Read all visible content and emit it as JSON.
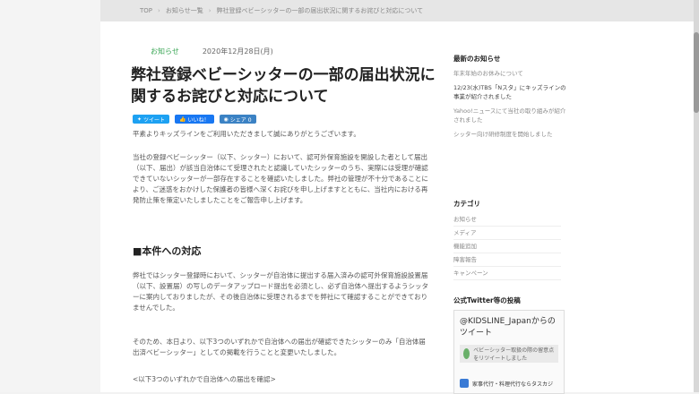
{
  "breadcrumb": {
    "home": "TOP",
    "section": "お知らせ一覧",
    "current": "弊社登録ベビーシッターの一部の届出状況に関するお詫びと対応について"
  },
  "article": {
    "category": "お知らせ",
    "date": "2020年12月28日(月)",
    "title": "弊社登録ベビーシッターの一部の届出状況に関するお詫びと対応について",
    "share": {
      "twitter": "ツイート",
      "facebook": "いいね！",
      "share": "シェア 0"
    },
    "p1": "平素よりキッズラインをご利用いただきまして誠にありがとうございます。",
    "p2": "当社の登録ベビーシッター（以下、シッター）において、認可外保育施設を開設した者として届出（以下、届出）が該当自治体にて受理されたと認識していたシッターのうち、実際には受理が確認できていないシッターが一部存在することを確認いたしました。弊社の管理が不十分であることにより、ご迷惑をおかけした保護者の皆様へ深くお詫びを申し上げますとともに、当社内における再発防止策を策定いたしましたことをご報告申し上げます。",
    "h2": "■本件への対応",
    "p3": "弊社ではシッター登録時において、シッターが自治体に提出する届入済みの認可外保育施設設置届（以下、設置届）の写しのデータアップロード提出を必須とし、必ず自治体へ提出するようシッターに案内しておりましたが、その後自治体に受理されるまでを弊社にて確認することができておりませんでした。",
    "p4": "そのため、本日より、以下3つのいずれかで自治体への届出が確認できたシッターのみ「自治体届出済ベビーシッター」としての掲載を行うことと変更いたしました。",
    "p5": "<以下3つのいずれかで自治体への届出を確認>"
  },
  "sidebar": {
    "news_heading": "最新のお知らせ",
    "news": [
      "年末年始のお休みについて",
      "12/23(水)TBS「Nスタ」にキッズラインの事業が紹介されました",
      "Yahoo!ニュースにて当社の取り組みが紹介されました",
      "シッター向け研修制度を開始しました"
    ],
    "category_heading": "カテゴリ",
    "categories": [
      "お知らせ",
      "メディア",
      "機能追加",
      "障害報告",
      "キャンペーン"
    ],
    "twitter_heading": "公式Twitter等の投稿",
    "twitter_title": "@KIDSLINE_Japanからのツイート",
    "twitter_card": "ベビーシッター取扱の際の留意点をリツイートしました",
    "twitter_foot": "家事代行・料理代行ならタスカジ"
  },
  "colors": {
    "accent_green": "#3aa655",
    "twitter_blue": "#1da1f2",
    "facebook_blue": "#1877f2"
  }
}
